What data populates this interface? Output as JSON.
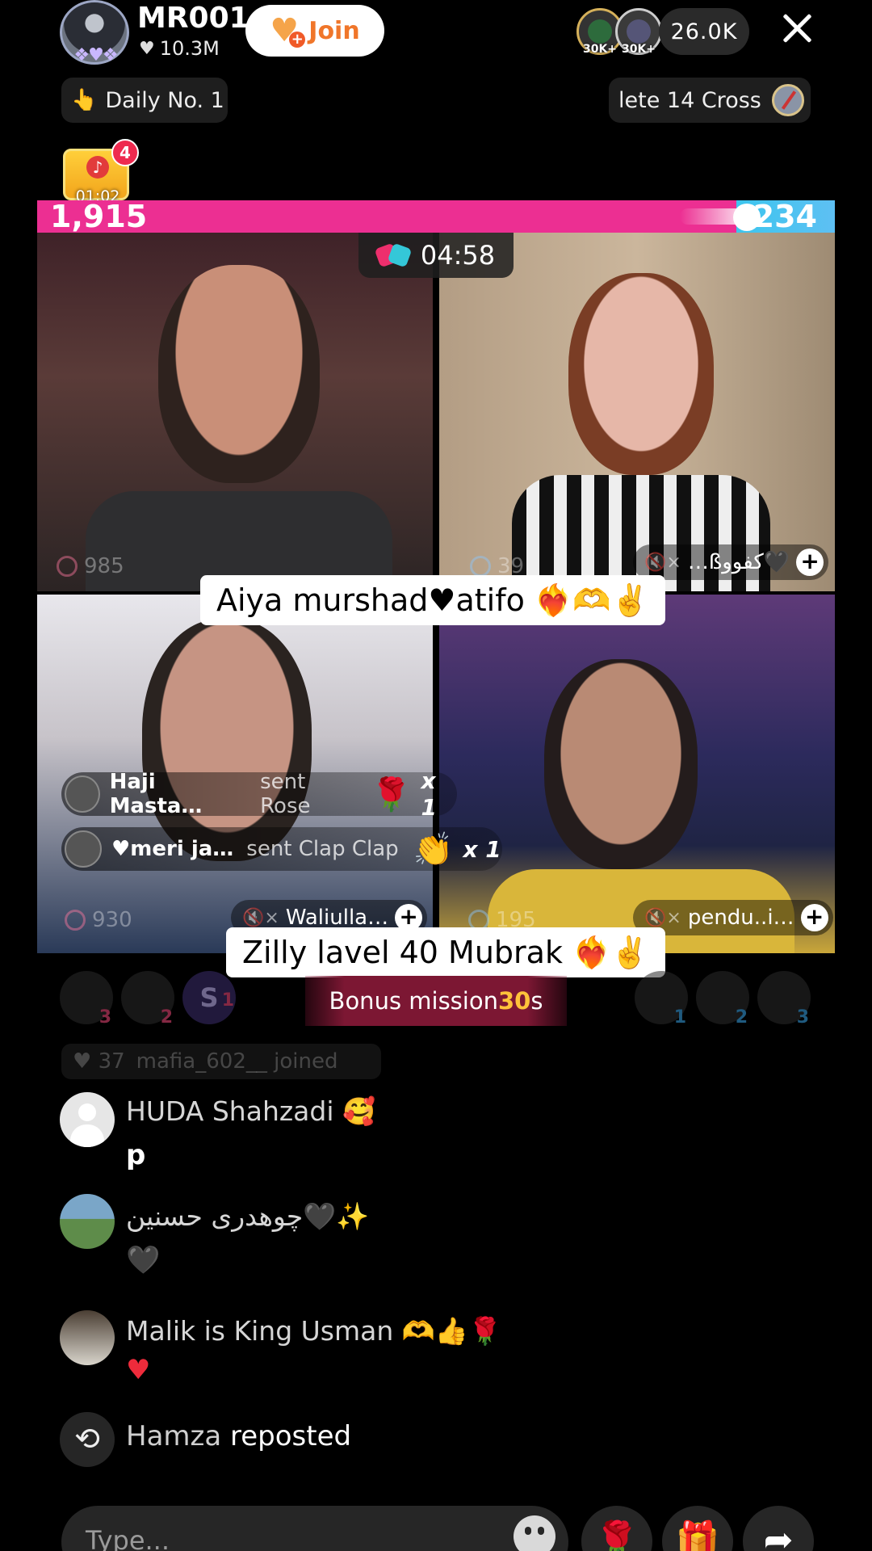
{
  "header": {
    "host_name": "MR001",
    "host_likes": "10.3M",
    "join_label": "Join",
    "viewer_badges": [
      "30K+",
      "30K+"
    ],
    "viewer_count": "26.0K"
  },
  "pills": {
    "daily": "Daily No. 1",
    "cross": "lete 14 Cross"
  },
  "treasure": {
    "badge": "4",
    "timer": "01:02"
  },
  "battle": {
    "left_score": "1,915",
    "right_score": "234",
    "timer": "04:58",
    "colors": {
      "left": "#ec2f92",
      "right": "#3cc5ee"
    }
  },
  "videos": {
    "v1_score": "985",
    "v2_score": "39",
    "v2_user": "…ßکفوو🖤",
    "v3_score": "930",
    "v3_user": "Waliulla…",
    "v4_score": "195",
    "v4_user": "pendu..i…"
  },
  "captions": {
    "first": "Aiya murshad♥atifo ❤️‍🔥🫶✌️",
    "second": "Zilly lavel 40 Mubrak ❤️‍🔥✌️"
  },
  "gifts": [
    {
      "user": "Haji Masta…",
      "action": "sent Rose",
      "emoji": "🌹",
      "count": "x 1"
    },
    {
      "user": "♥meri ja…",
      "action": "sent Clap Clap",
      "emoji": "👏",
      "count": "x 1"
    }
  ],
  "mission": {
    "left_ranks": [
      "3",
      "2",
      "1"
    ],
    "left_letter": "S",
    "right_ranks": [
      "1",
      "2",
      "3"
    ],
    "bonus_prefix": "Bonus mission ",
    "bonus_num": "30",
    "bonus_suffix": "s"
  },
  "joined": {
    "level": "37",
    "text": "mafia_602__ joined"
  },
  "chat": [
    {
      "name": "HUDA Shahzadi 🥰",
      "message": "p"
    },
    {
      "name": "چوھدری حسنین🖤✨",
      "message": "🖤"
    },
    {
      "name": "Malik is King Usman 🫶👍🌹",
      "message": "♥"
    }
  ],
  "repost": {
    "name": "Hamza",
    "action": " reposted"
  },
  "bottom": {
    "placeholder": "Type...",
    "rose_icon": "🌹",
    "gift_icon": "🎁",
    "share_icon": "➦"
  }
}
